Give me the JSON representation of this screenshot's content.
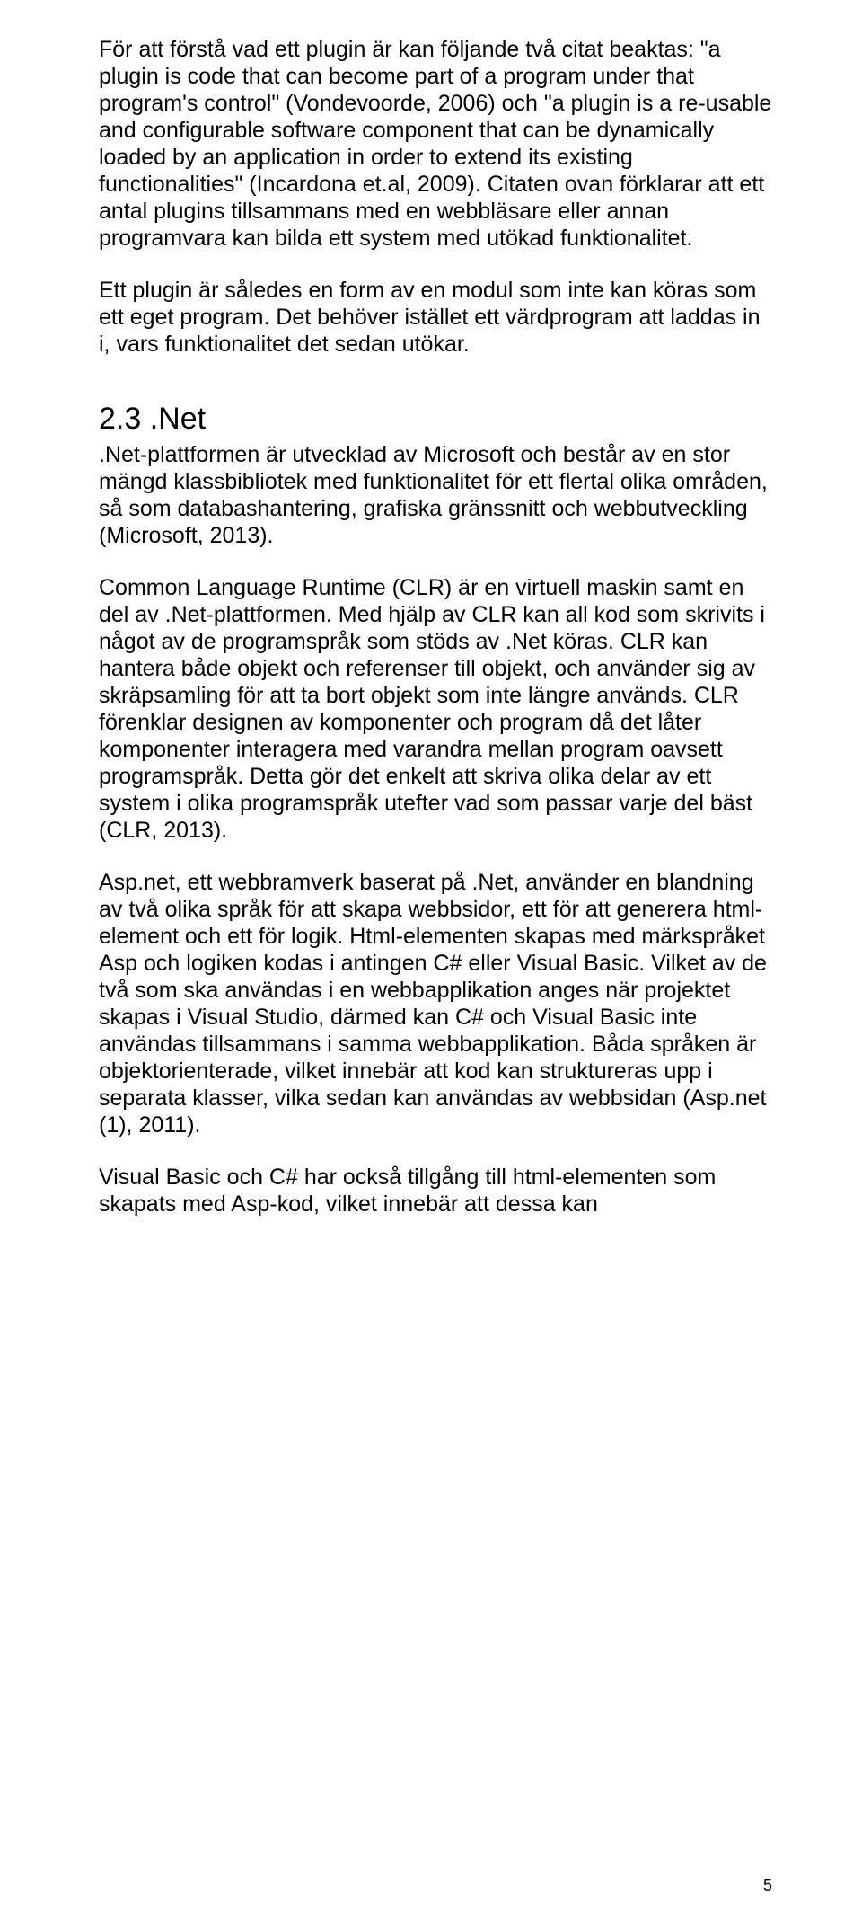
{
  "paragraphs": {
    "p1": "För att förstå vad ett plugin är kan följande två citat beaktas: \"a plugin is code that can become part of a program under that program's control\" (Vondevoorde, 2006) och \"a plugin is a re-usable and configurable software component that can be dynamically loaded by an application in order to extend its existing functionalities\" (Incardona et.al, 2009). Citaten ovan förklarar att ett antal plugins tillsammans med en webbläsare eller annan programvara kan bilda ett system med utökad funktionalitet.",
    "p2": "Ett plugin är således en form av en modul som inte kan köras som ett eget program. Det behöver istället ett värdprogram att laddas in i, vars funktionalitet det sedan utökar.",
    "heading": "2.3 .Net",
    "p3": ".Net-plattformen är utvecklad av Microsoft och består av en stor mängd klassbibliotek med funktionalitet för ett flertal olika områden, så som databashantering, grafiska gränssnitt och webbutveckling (Microsoft, 2013).",
    "p4": "Common Language Runtime (CLR) är en virtuell maskin samt en del av .Net-plattformen. Med hjälp av CLR kan all kod som skrivits i något av de programspråk som stöds av .Net köras. CLR kan hantera både objekt och referenser till objekt, och använder sig av skräpsamling för att ta bort objekt som inte längre används. CLR förenklar designen av komponenter och program då det låter komponenter interagera med varandra mellan program oavsett programspråk. Detta gör det enkelt att skriva olika delar av ett system i olika programspråk utefter vad som passar varje del bäst (CLR, 2013).",
    "p5": "Asp.net, ett webbramverk baserat på .Net, använder en blandning av två olika språk för att skapa webbsidor, ett för att generera html-element och ett för logik. Html-elementen skapas med märkspråket Asp och logiken kodas i antingen C# eller Visual Basic. Vilket av de två som ska användas i en webbapplikation anges när projektet skapas i Visual Studio, därmed kan C# och Visual Basic inte användas tillsammans i samma webbapplikation. Båda språken är objektorienterade, vilket innebär att kod kan struktureras upp i separata klasser, vilka sedan kan användas av webbsidan (Asp.net (1), 2011).",
    "p6": "Visual Basic och C# har också tillgång till html-elementen som skapats med Asp-kod, vilket innebär att dessa kan"
  },
  "page_number": "5"
}
